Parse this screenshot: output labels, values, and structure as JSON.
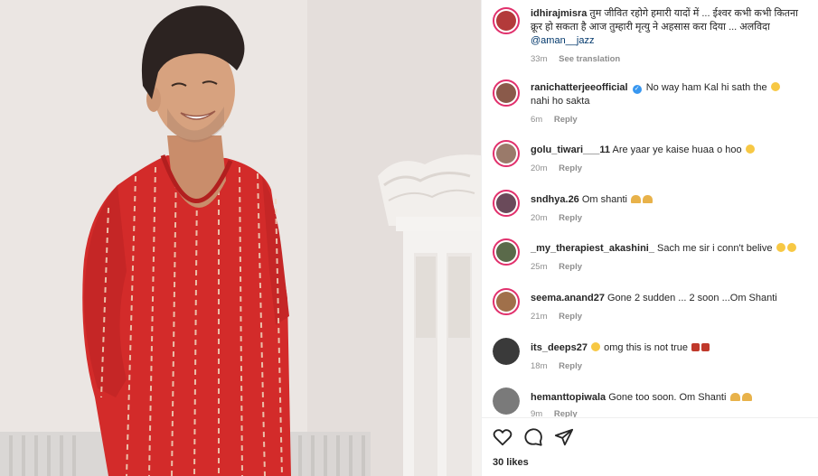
{
  "post": {
    "likes": "30 likes",
    "actions": {
      "like": "heart-icon",
      "comment": "comment-icon",
      "share": "share-icon"
    }
  },
  "comments": [
    {
      "username": "idhirajmisra",
      "verified": false,
      "text": "तुम जीवित रहोगे हमारी यादों में ... ईश्वर कभी कभी कितना क्रूर हो सकता है आज तुम्हारी मृत्यु ने अहसास करा दिया ... अलविदा",
      "mention": "@aman__jazz",
      "time": "33m",
      "action": "See translation",
      "emoji": [],
      "avatar_color": "#b33a3a"
    },
    {
      "username": "ranichatterjeeofficial",
      "verified": true,
      "text": "No way ham Kal hi sath the",
      "text2": "nahi ho sakta",
      "time": "6m",
      "action": "Reply",
      "avatar_color": "#8a5a4a"
    },
    {
      "username": "golu_tiwari___11",
      "text": "Are yaar ye kaise huaa o hoo",
      "time": "20m",
      "action": "Reply",
      "avatar_color": "#9a7a6a"
    },
    {
      "username": "sndhya.26",
      "text": "Om shanti",
      "time": "20m",
      "action": "Reply",
      "avatar_color": "#6a4a5a"
    },
    {
      "username": "_my_therapiest_akashini_",
      "text": "Sach me sir i conn't belive",
      "time": "25m",
      "action": "Reply",
      "avatar_color": "#5a6a4a"
    },
    {
      "username": "seema.anand27",
      "text": "Gone 2 sudden ... 2 soon ...Om Shanti",
      "time": "21m",
      "action": "Reply",
      "avatar_color": "#a0704a"
    },
    {
      "username": "its_deeps27",
      "text": "omg this is not true",
      "time": "18m",
      "action": "Reply",
      "avatar_color": "#3a3a3a"
    },
    {
      "username": "hemanttopiwala",
      "text": "Gone too soon. Om Shanti",
      "time": "9m",
      "action": "Reply",
      "avatar_color": "#7a7a7a"
    }
  ],
  "colors": {
    "kurta": "#d42a2a",
    "story_ring": "#e1306c",
    "verified": "#3897f0",
    "meta_text": "#8e8e8e"
  }
}
